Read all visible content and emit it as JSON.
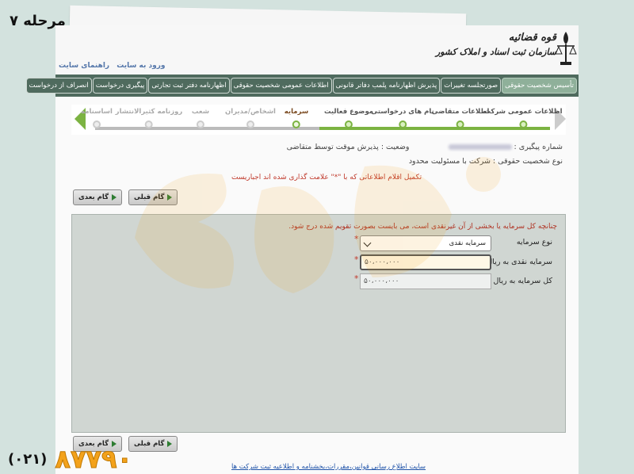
{
  "overlay": {
    "step_label": "مرحله ۷"
  },
  "header": {
    "org_line1": "قوه قضائیه",
    "org_line2": "سازمان ثبت اسناد و املاک کشور",
    "links": [
      "ورود به سایت",
      "راهنمای سایت"
    ]
  },
  "nav": [
    {
      "label": "تأسیس شخصیت حقوقی",
      "active": true
    },
    {
      "label": "صورتجلسه تغییرات"
    },
    {
      "label": "پذیرش اظهارنامه پلمب دفاتر قانونی"
    },
    {
      "label": "اطلاعات عمومی شخصیت حقوقی"
    },
    {
      "label": "اظهارنامه دفتر ثبت تجارتی"
    },
    {
      "label": "پیگیری درخواست"
    },
    {
      "label": "انصراف از درخواست"
    }
  ],
  "wizard": {
    "steps": [
      {
        "label": "اطلاعات عمومی شرکت",
        "state": "done"
      },
      {
        "label": "اطلاعات متقاضی",
        "state": "done"
      },
      {
        "label": "نام های درخواستی",
        "state": "done"
      },
      {
        "label": "موضوع فعالیت",
        "state": "done"
      },
      {
        "label": "سرمایه",
        "state": "current"
      },
      {
        "label": "اشخاص/مدیران",
        "state": "todo"
      },
      {
        "label": "شعب",
        "state": "todo"
      },
      {
        "label": "روزنامه کثیرالانتشار",
        "state": "todo"
      },
      {
        "label": "اساسنامه",
        "state": "todo"
      }
    ]
  },
  "info": {
    "tracking_label": "شماره پیگیری :",
    "status": "وضعیت : پذیرش موقت توسط متقاضی",
    "entity_type": "نوع شخصیت حقوقی : شرکت با مسئولیت محدود"
  },
  "required_note": "تکمیل اقلام اطلاعاتی که با \"*\" علامت گذاری شده اند اجباریست",
  "buttons": {
    "next": "گام بعدی",
    "prev": "گام قبلی"
  },
  "form": {
    "note": "چنانچه کل سرمایه یا بخشی از آن غیرنقدی است، می بایست بصورت تقویم شده درج شود.",
    "capital_type_label": "نوع سرمایه",
    "capital_type_value": "سرمایه نقدی",
    "cash_capital_label": "سرمایه نقدی به ریال",
    "cash_capital_value": "۵۰،۰۰۰،۰۰۰",
    "total_capital_label": "کل سرمایه به ریال",
    "total_capital_value": "۵۰،۰۰۰،۰۰۰"
  },
  "footer": {
    "link": "سایت اطلاع رسانی قوانین،مقررات،بخشنامه و اطلاعیه ثبت شرکت ها"
  },
  "phone": {
    "area": "(۰۲۱)",
    "number": "۸۷۷۹۰"
  },
  "colors": {
    "nav_bg": "#4f6b5e",
    "accent_green": "#7cb342",
    "watermark": "#f3a21b"
  }
}
